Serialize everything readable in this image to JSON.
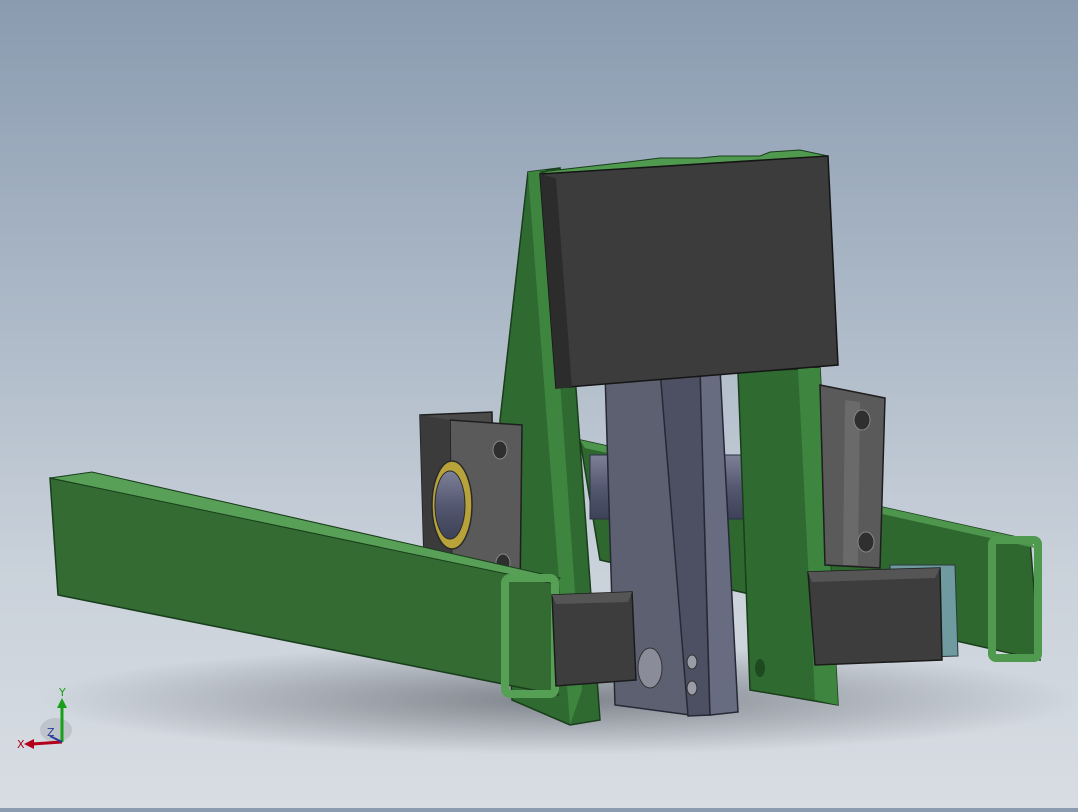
{
  "viewport": {
    "triad": {
      "x_label": "X",
      "y_label": "Y",
      "z_label": "Z",
      "x_color": "#b3001b",
      "y_color": "#18a018",
      "z_color": "#2a3a9a"
    }
  },
  "colors": {
    "frame_green": "#2f6b31",
    "frame_green_light": "#4f9a4f",
    "block_dark": "#3a3a3a",
    "shaft_blue": "#5c6078",
    "bearing_gold": "#b8a23a"
  }
}
